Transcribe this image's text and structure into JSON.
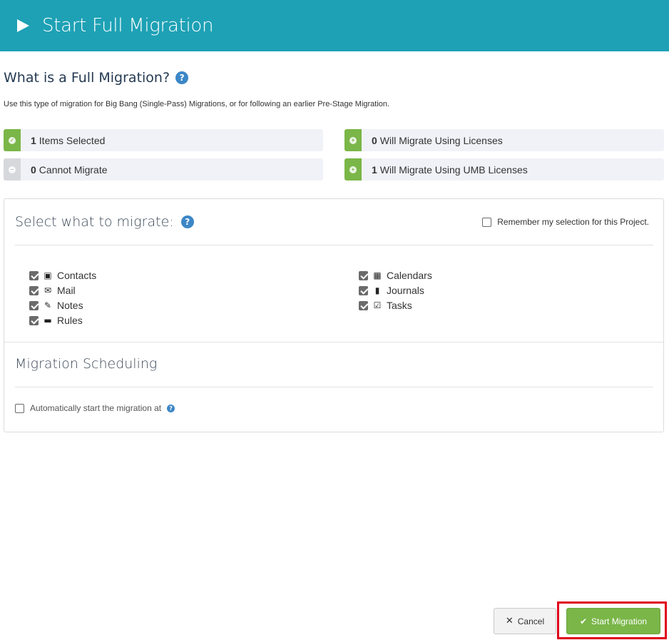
{
  "header": {
    "title": "Start Full Migration",
    "icon": "play-icon"
  },
  "intro": {
    "title": "What is a Full Migration?",
    "description": "Use this type of migration for Big Bang (Single-Pass) Migrations, or for following an earlier Pre-Stage Migration."
  },
  "stats": {
    "items_selected": {
      "count": "1",
      "label": "Items Selected"
    },
    "cannot_migrate": {
      "count": "0",
      "label": "Cannot Migrate"
    },
    "licenses": {
      "count": "0",
      "label": "Will Migrate Using Licenses"
    },
    "umb_licenses": {
      "count": "1",
      "label": "Will Migrate Using UMB Licenses"
    }
  },
  "select": {
    "title": "Select what to migrate:",
    "remember_label": "Remember my selection for this Project.",
    "remember_checked": false,
    "items": [
      {
        "label": "Contacts",
        "icon": "contacts-icon",
        "checked": true
      },
      {
        "label": "Mail",
        "icon": "envelope-icon",
        "checked": true
      },
      {
        "label": "Notes",
        "icon": "note-edit-icon",
        "checked": true
      },
      {
        "label": "Rules",
        "icon": "folder-icon",
        "checked": true
      },
      {
        "label": "Calendars",
        "icon": "calendar-icon",
        "checked": true
      },
      {
        "label": "Journals",
        "icon": "journal-icon",
        "checked": true
      },
      {
        "label": "Tasks",
        "icon": "clipboard-check-icon",
        "checked": true
      }
    ]
  },
  "scheduling": {
    "title": "Migration Scheduling",
    "auto_label": "Automatically start the migration at",
    "auto_checked": false
  },
  "buttons": {
    "cancel": "Cancel",
    "start": "Start Migration"
  },
  "colors": {
    "header": "#1ea1b5",
    "accent_green": "#7ab648",
    "help_blue": "#3c87c7",
    "highlight_red": "#e0001a"
  }
}
